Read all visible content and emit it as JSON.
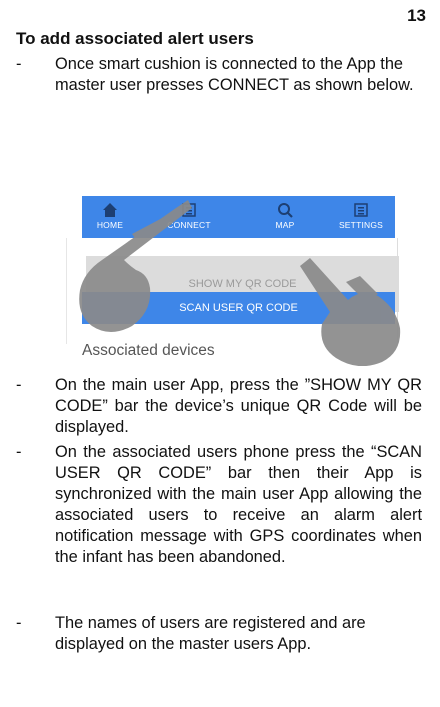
{
  "page_number": "13",
  "heading": "To add associated alert users",
  "bullets": [
    {
      "dash": "-",
      "text": "Once smart cushion is connected to the App the master user presses  CONNECT as shown below."
    },
    {
      "dash": "-",
      "text": "On the main user App, press the ”SHOW MY QR CODE” bar the device’s unique QR Code will be  displayed."
    },
    {
      "dash": "-",
      "text": "On the associated users phone press the “SCAN USER QR CODE” bar then their App is synchronized with the main user App allowing the associated users to receive an alarm alert notification message with GPS coordinates when the  infant  has been abandoned."
    },
    {
      "dash": "-",
      "text": "The names of users are registered and are displayed on the master users App."
    }
  ],
  "app_screenshot": {
    "nav": [
      {
        "label": "HOME",
        "icon": "home-icon"
      },
      {
        "label": "CONNECT",
        "icon": "connect-icon"
      },
      {
        "label": "MAP",
        "icon": "search-icon"
      },
      {
        "label": "SETTINGS",
        "icon": "settings-icon"
      }
    ],
    "show_qr_label": "SHOW MY QR CODE",
    "scan_qr_label": "SCAN USER QR CODE",
    "associated_devices_label": "Associated devices",
    "accent_color": "#3e86e8"
  }
}
